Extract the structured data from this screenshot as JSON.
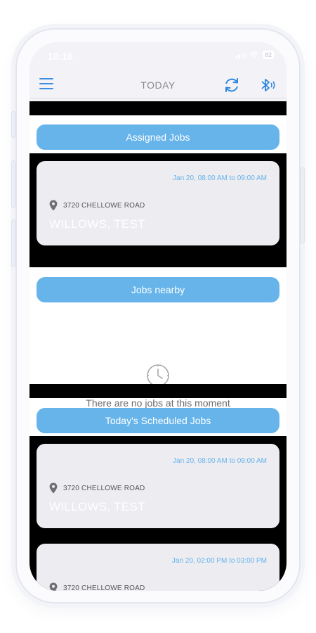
{
  "status_bar": {
    "time": "10:16",
    "battery": "82"
  },
  "nav": {
    "title": "TODAY",
    "icons": [
      "menu-icon",
      "sync-icon",
      "bluetooth-icon"
    ]
  },
  "colors": {
    "accent": "#3e8fe0",
    "section_header": "#66b4ea",
    "card": "#ececf1",
    "band": "#000000"
  },
  "assigned": {
    "header": "Assigned Jobs",
    "jobs": [
      {
        "time": "Jan 20, 08:00 AM to 09:00 AM",
        "address": "3720 CHELLOWE ROAD",
        "client": "WILLOWS, TEST"
      }
    ]
  },
  "nearby": {
    "header": "Jobs nearby",
    "empty_text": "There are no jobs at this moment"
  },
  "scheduled": {
    "header": "Today's Scheduled Jobs",
    "jobs": [
      {
        "time": "Jan 20, 08:00 AM to 09:00 AM",
        "address": "3720 CHELLOWE ROAD",
        "client": "WILLOWS, TEST"
      },
      {
        "time": "Jan 20, 02:00 PM to 03:00 PM",
        "address": "3720 CHELLOWE ROAD",
        "client": ""
      }
    ]
  }
}
